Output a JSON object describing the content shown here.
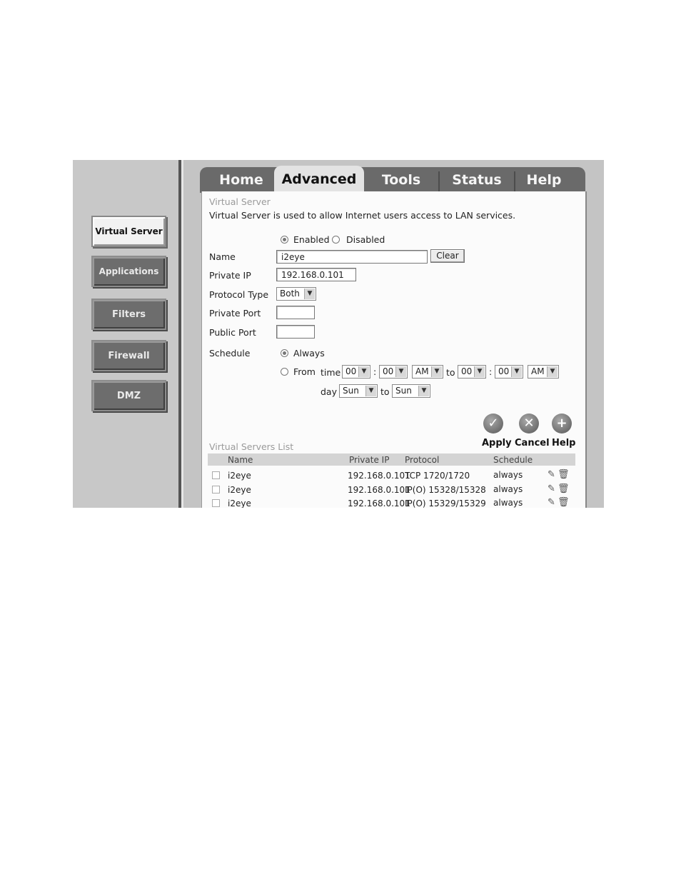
{
  "sidebar": {
    "items": [
      {
        "label": "Virtual Server",
        "active": true
      },
      {
        "label": "Applications",
        "active": false
      },
      {
        "label": "Filters",
        "active": false
      },
      {
        "label": "Firewall",
        "active": false
      },
      {
        "label": "DMZ",
        "active": false
      }
    ]
  },
  "tabs": [
    {
      "label": "Home",
      "active": false
    },
    {
      "label": "Advanced",
      "active": true
    },
    {
      "label": "Tools",
      "active": false
    },
    {
      "label": "Status",
      "active": false
    },
    {
      "label": "Help",
      "active": false
    }
  ],
  "virtual_server": {
    "title": "Virtual Server",
    "description": "Virtual Server is used to allow Internet users access to LAN services.",
    "enabled_label": "Enabled",
    "disabled_label": "Disabled",
    "enabled_selected": true,
    "name_label": "Name",
    "name_value": "i2eye",
    "clear_label": "Clear",
    "private_ip_label": "Private IP",
    "private_ip_value": "192.168.0.101",
    "protocol_type_label": "Protocol Type",
    "protocol_type_value": "Both",
    "private_port_label": "Private Port",
    "private_port_value": "",
    "public_port_label": "Public Port",
    "public_port_value": "",
    "schedule_label": "Schedule",
    "always_label": "Always",
    "from_label": "From",
    "time_label": "time",
    "to_label": "to",
    "day_label": "day",
    "colon": ":",
    "from_hour": "00",
    "from_min": "00",
    "from_ampm": "AM",
    "to_hour": "00",
    "to_min": "00",
    "to_ampm": "AM",
    "day_from": "Sun",
    "day_to": "Sun"
  },
  "actions": {
    "apply": "Apply",
    "cancel": "Cancel",
    "help": "Help"
  },
  "list": {
    "title": "Virtual Servers List",
    "headers": {
      "name": "Name",
      "private_ip": "Private IP",
      "protocol": "Protocol",
      "schedule": "Schedule"
    },
    "rows": [
      {
        "name": "i2eye",
        "private_ip": "192.168.0.101",
        "protocol": "TCP 1720/1720",
        "schedule": "always"
      },
      {
        "name": "i2eye",
        "private_ip": "192.168.0.101",
        "protocol": "IP(O) 15328/15328",
        "schedule": "always"
      },
      {
        "name": "i2eye",
        "private_ip": "192.168.0.101",
        "protocol": "IP(O) 15329/15329",
        "schedule": "always"
      }
    ]
  },
  "icons": {
    "apply": "checkmark-icon",
    "cancel": "x-icon",
    "help": "plus-icon",
    "edit": "edit-icon",
    "delete": "trash-icon",
    "dropdown": "chevron-down-icon"
  }
}
